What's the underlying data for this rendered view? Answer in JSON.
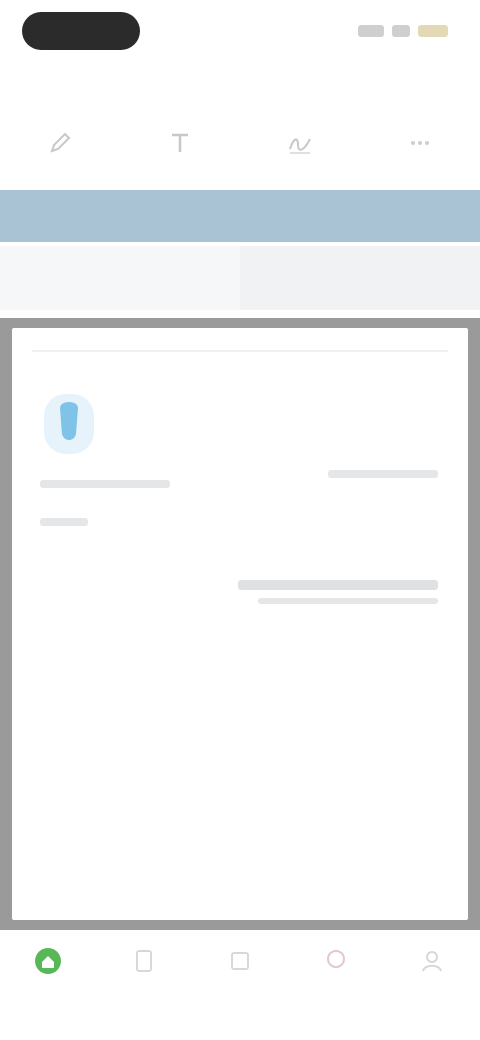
{
  "status_bar": {
    "icons": [
      "signal-icon",
      "wifi-icon",
      "battery-icon"
    ]
  },
  "nav": {
    "left_label": "",
    "title": "",
    "right_label": ""
  },
  "tools": [
    {
      "icon": "pencil-icon",
      "label": ""
    },
    {
      "icon": "text-icon",
      "label": ""
    },
    {
      "icon": "signature-icon",
      "label": ""
    },
    {
      "icon": "more-icon",
      "label": ""
    }
  ],
  "segments": [
    {
      "label": "",
      "active": true
    },
    {
      "label": "",
      "active": false
    }
  ],
  "bottom_tabs": [
    {
      "icon": "home-icon",
      "label": "",
      "active": true
    },
    {
      "icon": "document-icon",
      "label": "",
      "active": false
    },
    {
      "icon": "scan-icon",
      "label": "",
      "active": false
    },
    {
      "icon": "share-icon",
      "label": "",
      "active": false
    },
    {
      "icon": "profile-icon",
      "label": "",
      "active": false
    }
  ],
  "colors": {
    "accent_green": "#58b858",
    "banner_blue": "#a9c3d4",
    "logo_blue": "#7fc3e8"
  }
}
